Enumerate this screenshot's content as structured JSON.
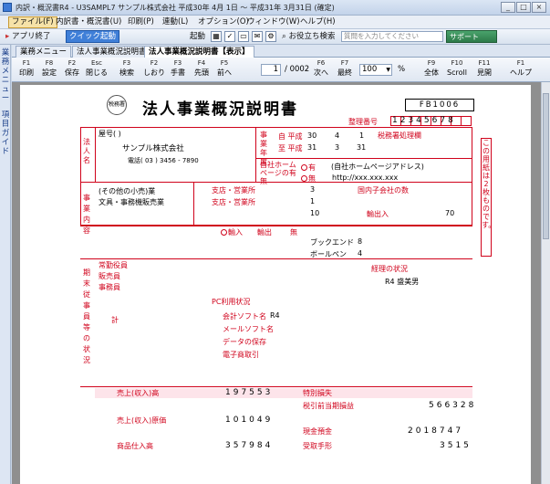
{
  "window": {
    "title": "内訳・概況書R4 - U3SAMPL7 サンプル株式会社 平成30年 4月 1日 ～ 平成31年 3月31日 (確定)",
    "buttons": [
      "_",
      "□",
      "×"
    ]
  },
  "menu": {
    "items": [
      "ファイル(F)",
      "内訳書・概況書(U)",
      "印刷(P)",
      "連動(L)",
      "オプション(O)",
      "ウィンドウ(W)",
      "ヘルプ(H)"
    ]
  },
  "toolbar": {
    "app_exit": "アプリ終了",
    "quick_launch": "クイック起動",
    "launch": "起動",
    "useful_search": "お役立ち検索",
    "search_placeholder": "質問を入力してください",
    "support": "サポート"
  },
  "sidebar": {
    "items": [
      "業務メニュー",
      "項目ガイド"
    ]
  },
  "tabs": [
    {
      "label": "業務メニュー",
      "active": false
    },
    {
      "label": "法人事業概況説明書",
      "active": false
    },
    {
      "label": "法人事業概況説明書【表示】",
      "active": true
    }
  ],
  "fkeys": [
    {
      "key": "F1",
      "label": "印刷"
    },
    {
      "key": "F8",
      "label": "設定"
    },
    {
      "key": "F2",
      "label": "保存"
    },
    {
      "key": "Esc",
      "label": "閉じる"
    },
    {
      "key": "F3",
      "label": "検索"
    },
    {
      "key": "F2",
      "label": "しおり"
    },
    {
      "key": "F3",
      "label": "手書"
    },
    {
      "key": "F4",
      "label": "先頭"
    },
    {
      "key": "F5",
      "label": "前へ"
    },
    {
      "key": "F6",
      "label": "次へ"
    },
    {
      "key": "F7",
      "label": "最終"
    },
    {
      "key": "F9",
      "label": "全体"
    },
    {
      "key": "F10",
      "label": "Scroll"
    },
    {
      "key": "F11",
      "label": "見開"
    },
    {
      "key": "F1",
      "label": "ヘルプ"
    }
  ],
  "paging": {
    "current": "1",
    "total": "/ 0002"
  },
  "zoom": {
    "value": "100",
    "unit": "%"
  },
  "document": {
    "title": "法人事業概況説明書",
    "form_no": "FB1006",
    "seal_text": "税務署",
    "seiri_label": "整理番号",
    "seiri_digits": "12345678",
    "company_label": "法人名",
    "furigana": "屋号( )",
    "company_name": "サンプル株式会社",
    "phone": "電話( 03 ) 3456 - 7890",
    "jigyo_label": "事業年度",
    "from_era": "自 平成",
    "from_ymd": [
      "30",
      "4",
      "1"
    ],
    "to_era": "至 平成",
    "to_ymd": [
      "31",
      "3",
      "31"
    ],
    "tax_office": "税務署処理欄",
    "homepage_label": "自社ホームページの有無",
    "homepage_yes": "有",
    "homepage_no": "無",
    "homepage_url_label": "(自社ホームページアドレス)",
    "homepage_url": "http://xxx.xxx.xxx",
    "business_label": "事業内容",
    "business_text": "文具・事務機販売業",
    "branch_label": "支店・営業所",
    "branch_count": "3",
    "branch_count2": "1",
    "branch_total": "10",
    "overseas_label": "国内子会社の数",
    "ratio_label": "輸出入",
    "ratio_value": "70",
    "import_label": "輸入",
    "export_label": "輸出",
    "trade_none": "無",
    "sales_3": "3",
    "sales_8": "8",
    "sales_4": "4",
    "product_a": "ブックエンド",
    "product_b": "ボールペン",
    "staff_label": "期末従事員等の状況",
    "staff_rows": [
      "常勤役員",
      "販売員",
      "事務員",
      "",
      "",
      "計"
    ],
    "pc_label": "PC利用状況",
    "account_soft": "会計ソフト名",
    "account_soft_value": "R4",
    "email_label": "メールソフト名",
    "data_save": "データの保存",
    "ec_label": "電子商取引",
    "sales_row_label": "売上(収入)高",
    "sales_value": "197553",
    "cost_label": "売上(収入)原価",
    "cost_value": "101049",
    "purchase_label": "商品仕入高",
    "purchase_value": "357984",
    "profit_label": "特別損失",
    "pretax_label": "税引前当期損益",
    "pretax_value": "566328",
    "deposit_label": "現金預金",
    "deposit_value": "2018747",
    "bill_label": "受取手形",
    "bill_value": "3515",
    "manager_label": "経理の状況",
    "manager_name": "R4 盛美男",
    "side_note": "この用紙は2枚ものです。"
  }
}
